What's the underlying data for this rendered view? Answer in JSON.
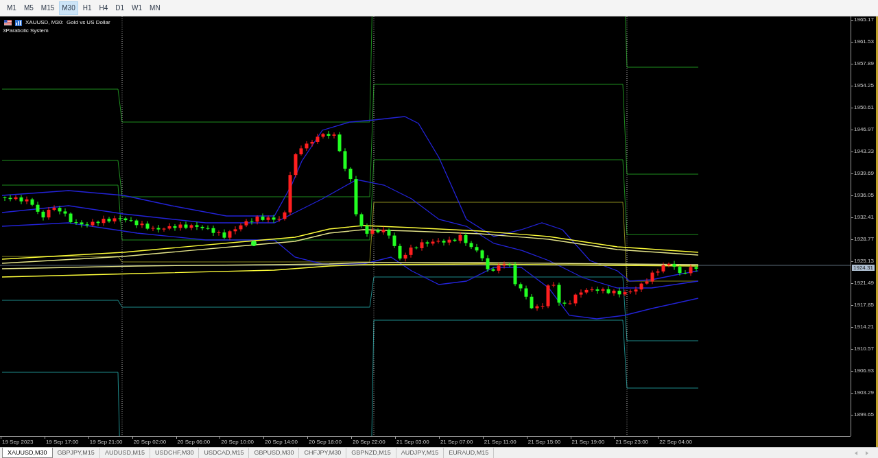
{
  "toolbar": {
    "timeframes": [
      {
        "label": "M1",
        "selected": false
      },
      {
        "label": "M5",
        "selected": false
      },
      {
        "label": "M15",
        "selected": false
      },
      {
        "label": "M30",
        "selected": true
      },
      {
        "label": "H1",
        "selected": false
      },
      {
        "label": "H4",
        "selected": false
      },
      {
        "label": "D1",
        "selected": false
      },
      {
        "label": "W1",
        "selected": false
      },
      {
        "label": "MN",
        "selected": false
      }
    ]
  },
  "chart": {
    "title": "XAUUSD, M30:  Gold vs US Dollar",
    "indicator": "3Parabolic System",
    "price_axis": {
      "labels": [
        "1965.17",
        "1961.53",
        "1957.89",
        "1954.25",
        "1950.61",
        "1946.97",
        "1943.33",
        "1939.69",
        "1936.05",
        "1932.41",
        "1928.77",
        "1925.13",
        "1921.49",
        "1917.85",
        "1914.21",
        "1910.57",
        "1906.93",
        "1903.29",
        "1899.65"
      ],
      "current_price": "1924.31"
    },
    "time_axis": {
      "labels": [
        "19 Sep 2023",
        "19 Sep 17:00",
        "19 Sep 21:00",
        "20 Sep 02:00",
        "20 Sep 06:00",
        "20 Sep 10:00",
        "20 Sep 14:00",
        "20 Sep 18:00",
        "20 Sep 22:00",
        "21 Sep 03:00",
        "21 Sep 07:00",
        "21 Sep 11:00",
        "21 Sep 15:00",
        "21 Sep 19:00",
        "21 Sep 23:00",
        "22 Sep 04:00"
      ]
    }
  },
  "symbol_tabs": [
    {
      "label": "XAUUSD,M30",
      "selected": true
    },
    {
      "label": "GBPJPY,M15",
      "selected": false
    },
    {
      "label": "AUDUSD,M15",
      "selected": false
    },
    {
      "label": "USDCHF,M30",
      "selected": false
    },
    {
      "label": "USDCAD,M15",
      "selected": false
    },
    {
      "label": "GBPUSD,M30",
      "selected": false
    },
    {
      "label": "CHFJPY,M30",
      "selected": false
    },
    {
      "label": "GBPNZD,M15",
      "selected": false
    },
    {
      "label": "AUDJPY,M15",
      "selected": false
    },
    {
      "label": "EURAUD,M15",
      "selected": false
    }
  ]
}
